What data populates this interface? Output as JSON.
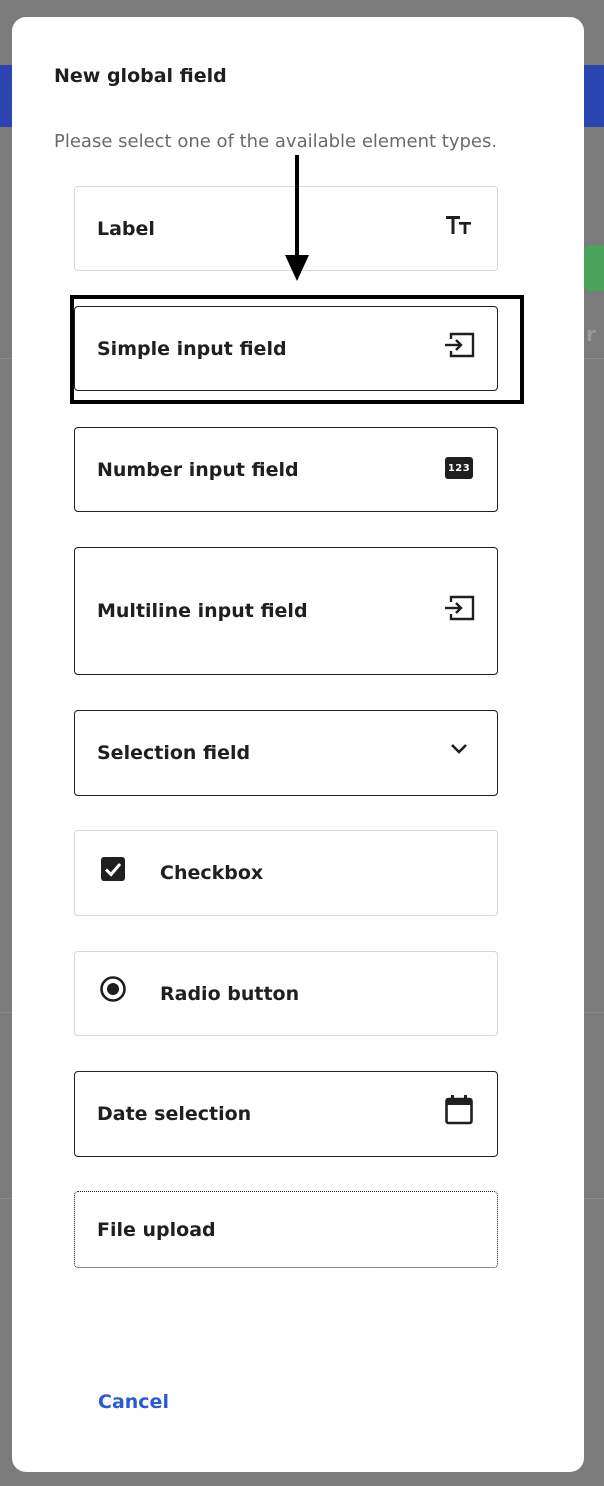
{
  "dialog": {
    "title": "New global field",
    "subtitle": "Please select one of the available element types."
  },
  "options": [
    {
      "label": "Label",
      "icon": "text-size-icon"
    },
    {
      "label": "Simple input field",
      "icon": "input-field-icon"
    },
    {
      "label": "Number input field",
      "icon": "number-123-icon"
    },
    {
      "label": "Multiline input field",
      "icon": "input-field-icon"
    },
    {
      "label": "Selection field",
      "icon": "chevron-down-icon"
    },
    {
      "label": "Checkbox",
      "icon": "checked-checkbox-icon"
    },
    {
      "label": "Radio button",
      "icon": "radio-selected-icon"
    },
    {
      "label": "Date selection",
      "icon": "calendar-icon"
    },
    {
      "label": "File upload",
      "icon": ""
    }
  ],
  "number_icon_text": "123",
  "actions": {
    "cancel_label": "Cancel"
  },
  "colors": {
    "accent": "#2a5bd7",
    "text": "#1f1f1f",
    "overlay": "#7b7b7b"
  }
}
